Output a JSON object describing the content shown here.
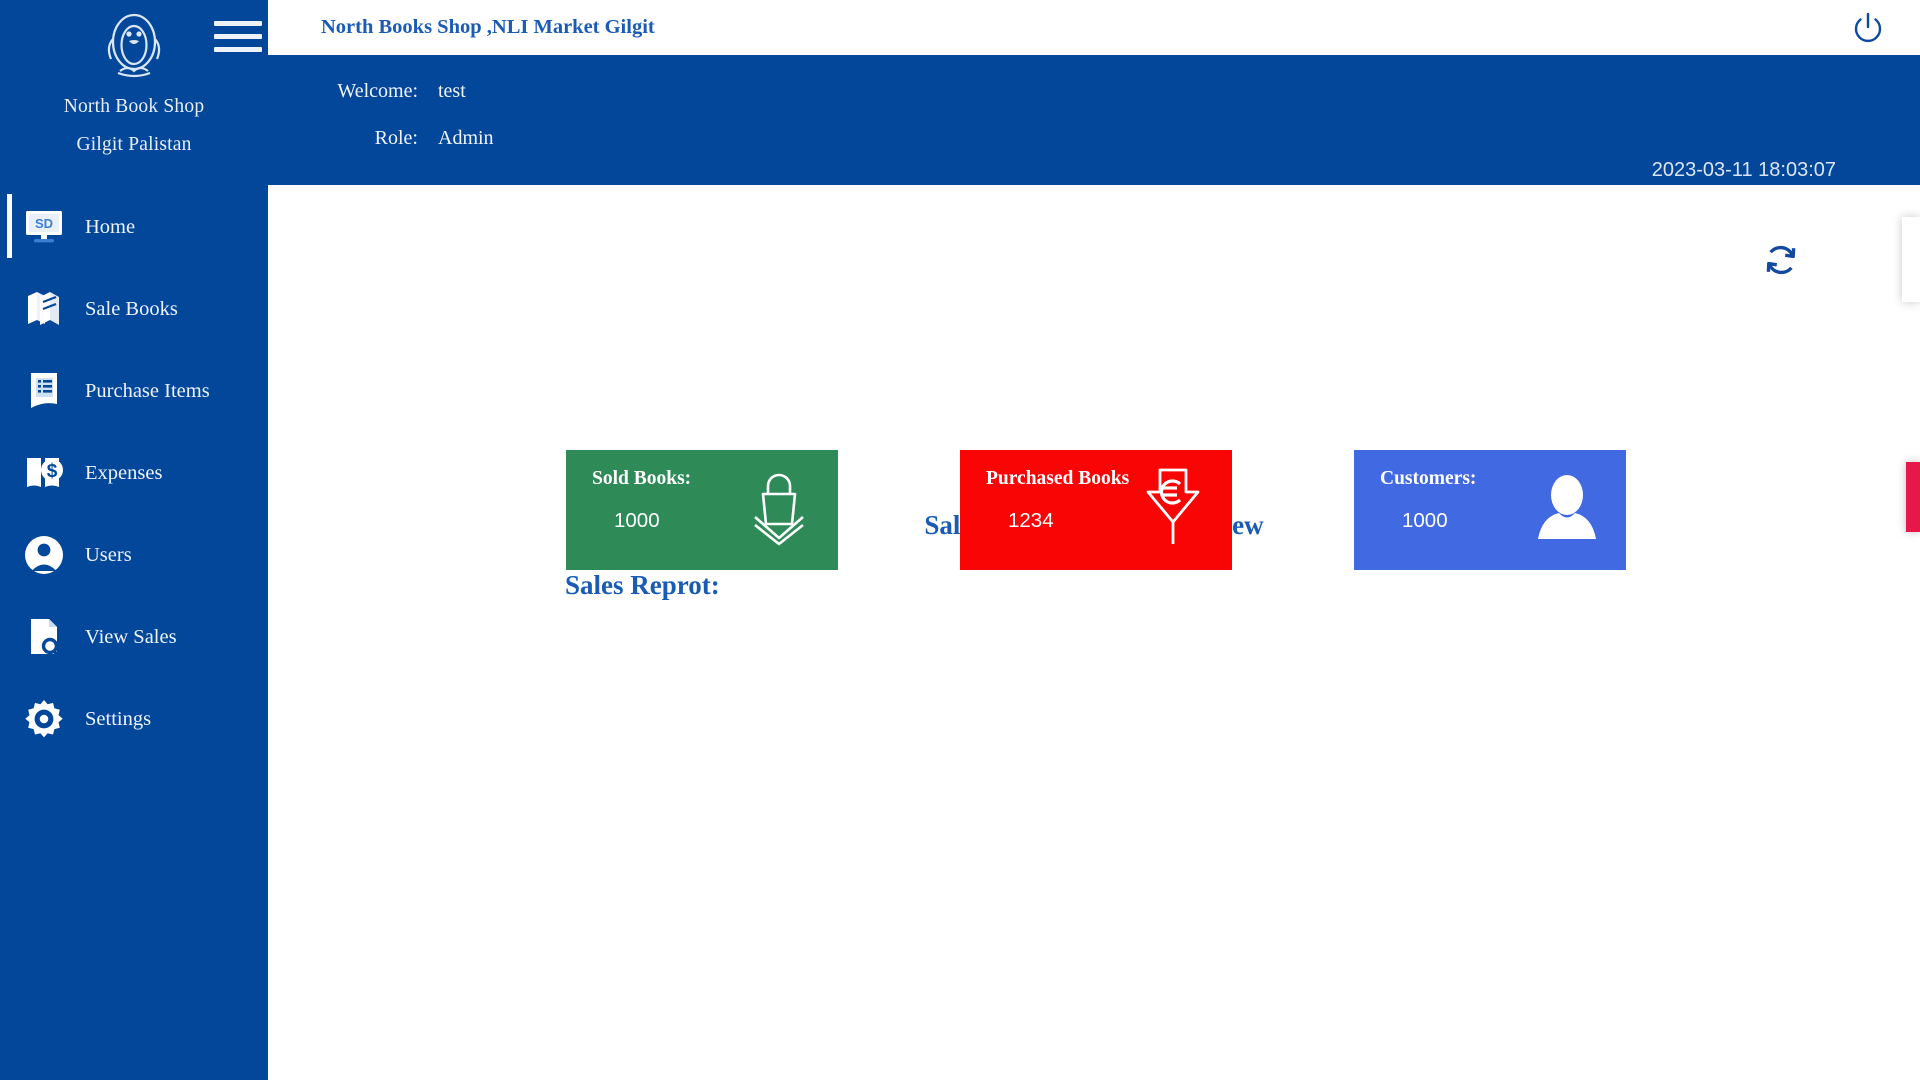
{
  "sidebar": {
    "logo_icon": "penguin-logo-icon",
    "brand_name": "North Book Shop",
    "brand_location": "Gilgit Palistan",
    "items": [
      {
        "label": "Home",
        "icon": "monitor-sd-icon",
        "active": true
      },
      {
        "label": "Sale Books",
        "icon": "books-stack-icon",
        "active": false
      },
      {
        "label": "Purchase Items",
        "icon": "invoice-list-icon",
        "active": false
      },
      {
        "label": "Expenses",
        "icon": "book-dollar-icon",
        "active": false
      },
      {
        "label": "Users",
        "icon": "user-circle-icon",
        "active": false
      },
      {
        "label": "View Sales",
        "icon": "document-search-icon",
        "active": false
      },
      {
        "label": "Settings",
        "icon": "gear-icon",
        "active": false
      }
    ]
  },
  "header": {
    "menu_toggle_icon": "hamburger-menu-icon",
    "title": "North Books Shop ,NLI Market Gilgit",
    "power_icon": "power-icon",
    "welcome_key": "Welcome:",
    "welcome_value": "test",
    "role_key": "Role:",
    "role_value": "Admin",
    "datetime": "2023-03-11 18:03:07"
  },
  "main": {
    "refresh_icon": "refresh-icon",
    "overview_title": "Sales and Purchase Overview",
    "report_title": "Sales Reprot:",
    "cards": [
      {
        "label": "Sold Books:",
        "value": "1000",
        "color": "#2e8b57",
        "icon": "shopping-bag-down-icon"
      },
      {
        "label": "Purchased Books",
        "value": "1234",
        "color": "#fa0505",
        "icon": "euro-arrow-down-icon"
      },
      {
        "label": "Customers:",
        "value": "1000",
        "color": "#4169e1",
        "icon": "person-avatar-icon"
      }
    ]
  },
  "colors": {
    "brand_blue": "#03479b",
    "title_blue": "#1a5bb5",
    "green": "#2e8b57",
    "red": "#fa0505",
    "royal_blue": "#4169e1",
    "edge_red": "#e8174a"
  }
}
